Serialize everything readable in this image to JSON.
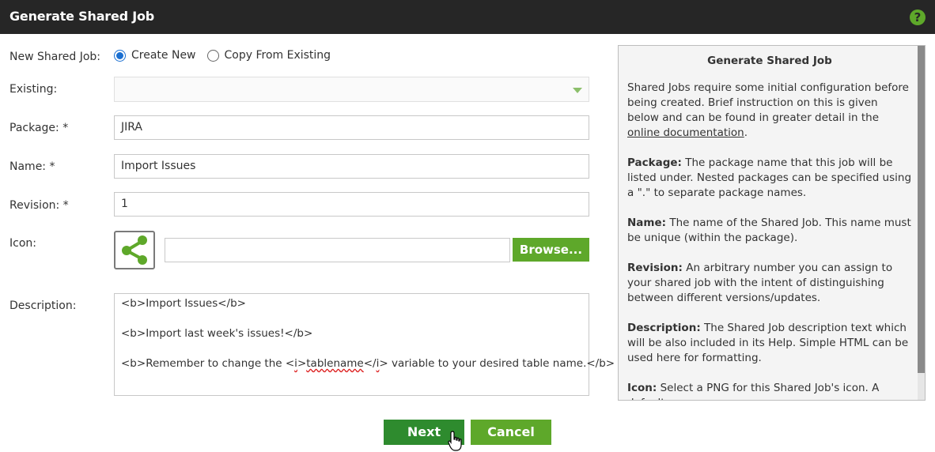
{
  "window": {
    "title": "Generate Shared Job",
    "help_glyph": "?"
  },
  "form": {
    "new_shared_job": {
      "label": "New Shared Job:",
      "options": [
        "Create New",
        "Copy From Existing"
      ],
      "selected": "Create New"
    },
    "existing": {
      "label": "Existing:",
      "value": ""
    },
    "package": {
      "label": "Package: *",
      "value": "JIRA"
    },
    "name": {
      "label": "Name: *",
      "value": "Import Issues"
    },
    "revision": {
      "label": "Revision: *",
      "value": "1"
    },
    "icon": {
      "label": "Icon:",
      "icon_name": "share-icon",
      "browse_label": "Browse...",
      "file_value": ""
    },
    "description": {
      "label": "Description:",
      "line1": "<b>Import Issues</b>",
      "line2": "<b>Import last week's issues!</b>",
      "line3_pre": "<b>Remember to change the <",
      "line3_i": "i",
      "line3_tag_close": ">",
      "line3_word": "tablename",
      "line3_post1": "</",
      "line3_i2": "i",
      "line3_post2": "> variable to your desired table name.</b>"
    }
  },
  "help": {
    "title": "Generate Shared Job",
    "intro_text": "Shared Jobs require some initial configuration before being created. Brief instruction on this is given below and can be found in greater detail in the",
    "intro_link": "online documentation",
    "intro_end": ".",
    "sections": [
      {
        "term": "Package:",
        "text": "The package name that this job will be listed under. Nested packages can be specified using a \".\" to separate package names."
      },
      {
        "term": "Name:",
        "text": "The name of the Shared Job. This name must be unique (within the package)."
      },
      {
        "term": "Revision:",
        "text": "An arbitrary number you can assign to your shared job with the intent of distinguishing between different versions/updates."
      },
      {
        "term": "Description:",
        "text": "The Shared Job description text which will be also included in its Help. Simple HTML can be used here for formatting."
      },
      {
        "term": "Icon:",
        "text": "Select a PNG for this Shared Job's icon. A default"
      }
    ]
  },
  "buttons": {
    "next": "Next",
    "cancel": "Cancel"
  },
  "colors": {
    "accent_green": "#5ea82a",
    "dark_green": "#2e8b2e",
    "titlebar": "#262626",
    "radio_blue": "#1a6fd1"
  }
}
